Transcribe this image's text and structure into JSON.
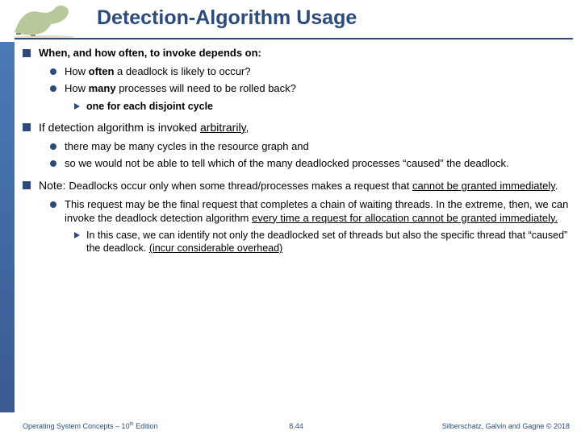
{
  "header": {
    "title": "Detection-Algorithm Usage"
  },
  "sections": [
    {
      "lead_pre": "When, and how often, to invoke depends on:",
      "subs": [
        {
          "pre": "How ",
          "b": "often",
          "post": " a deadlock is likely to occur?"
        },
        {
          "pre": "How ",
          "b": "many",
          "post": " processes will need to be rolled back?",
          "tris": [
            {
              "text": "one for each disjoint cycle"
            }
          ]
        }
      ]
    },
    {
      "lead_pre": "If detection algorithm is invoked ",
      "lead_u": "arbitrarily",
      "lead_post": ",",
      "subs": [
        {
          "text": "there may be many cycles in the resource graph and"
        },
        {
          "text": "so we would not be able to tell which of the many deadlocked processes “caused” the deadlock."
        }
      ]
    },
    {
      "lead_pre": "Note: ",
      "lead_post_span": "Deadlocks occur only when some thread/processes makes a request that ",
      "lead_u2": "cannot be granted immediately",
      "lead_post2": ".",
      "subs": [
        {
          "rich_pre": "This request may be the final request that completes a chain of waiting threads. In the extreme, then, we can invoke the deadlock detection algorithm ",
          "rich_u": "every time a request for allocation cannot be granted immediately.",
          "tris": [
            {
              "pre": "In this case, we can identify not only the deadlocked set of threads but also the specific thread that “caused” the deadlock. ",
              "u": "(incur considerable overhead)"
            }
          ]
        }
      ]
    }
  ],
  "footer": {
    "left_a": "Operating System Concepts – 10",
    "left_b": " Edition",
    "center": "8.44",
    "right": "Silberschatz, Galvin and Gagne © 2018"
  }
}
